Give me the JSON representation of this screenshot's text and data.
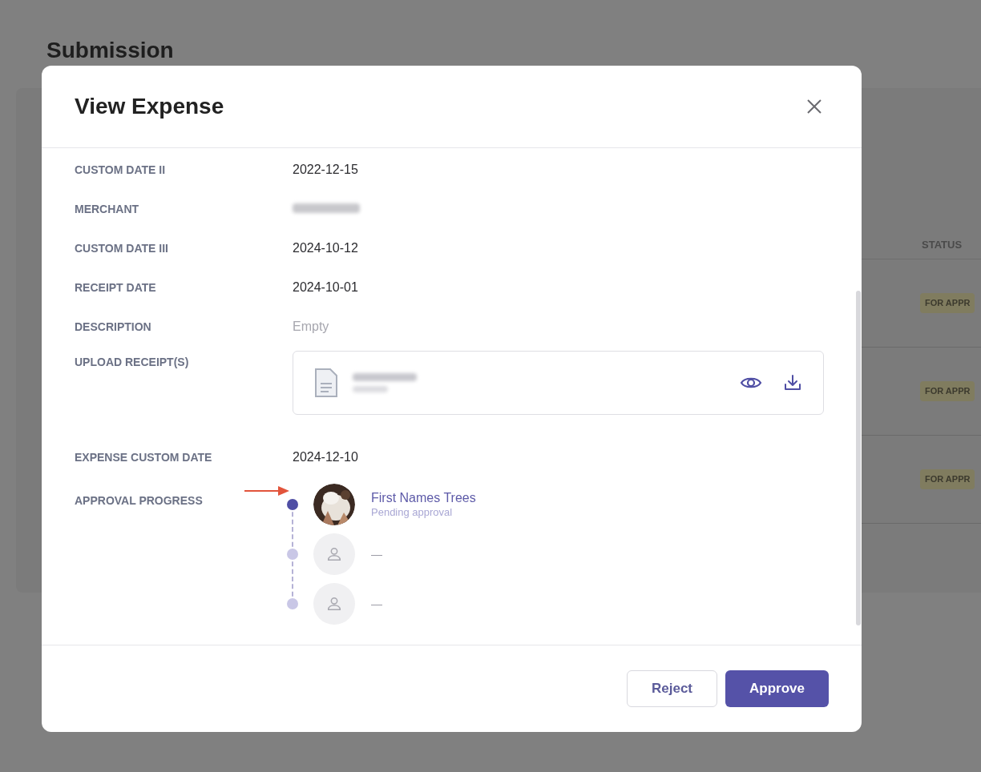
{
  "page": {
    "title": "Submission",
    "table": {
      "status_header": "STATUS",
      "rows": [
        {
          "status": "FOR APPR"
        },
        {
          "status": "FOR APPR"
        },
        {
          "status": "FOR APPR"
        }
      ]
    }
  },
  "modal": {
    "title": "View Expense",
    "fields": [
      {
        "kind": "text",
        "label": "CUSTOM DATE II",
        "value": "2022-12-15"
      },
      {
        "kind": "blurred",
        "label": "MERCHANT"
      },
      {
        "kind": "text",
        "label": "CUSTOM DATE III",
        "value": "2024-10-12"
      },
      {
        "kind": "text",
        "label": "RECEIPT DATE",
        "value": "2024-10-01"
      },
      {
        "kind": "empty",
        "label": "DESCRIPTION",
        "value": "Empty"
      },
      {
        "kind": "file",
        "label": "UPLOAD RECEIPT(S)"
      },
      {
        "kind": "text",
        "label": "EXPENSE CUSTOM DATE",
        "value": "2024-12-10"
      },
      {
        "kind": "approval",
        "label": "APPROVAL PROGRESS"
      }
    ],
    "approvers": [
      {
        "kind": "person",
        "current": true,
        "name": "First Names Trees",
        "status": "Pending approval"
      },
      {
        "kind": "placeholder",
        "current": false,
        "name": "—"
      },
      {
        "kind": "placeholder",
        "current": false,
        "name": "—"
      }
    ],
    "buttons": [
      {
        "kind": "secondary",
        "label": "Reject"
      },
      {
        "kind": "primary",
        "label": "Approve"
      }
    ]
  }
}
